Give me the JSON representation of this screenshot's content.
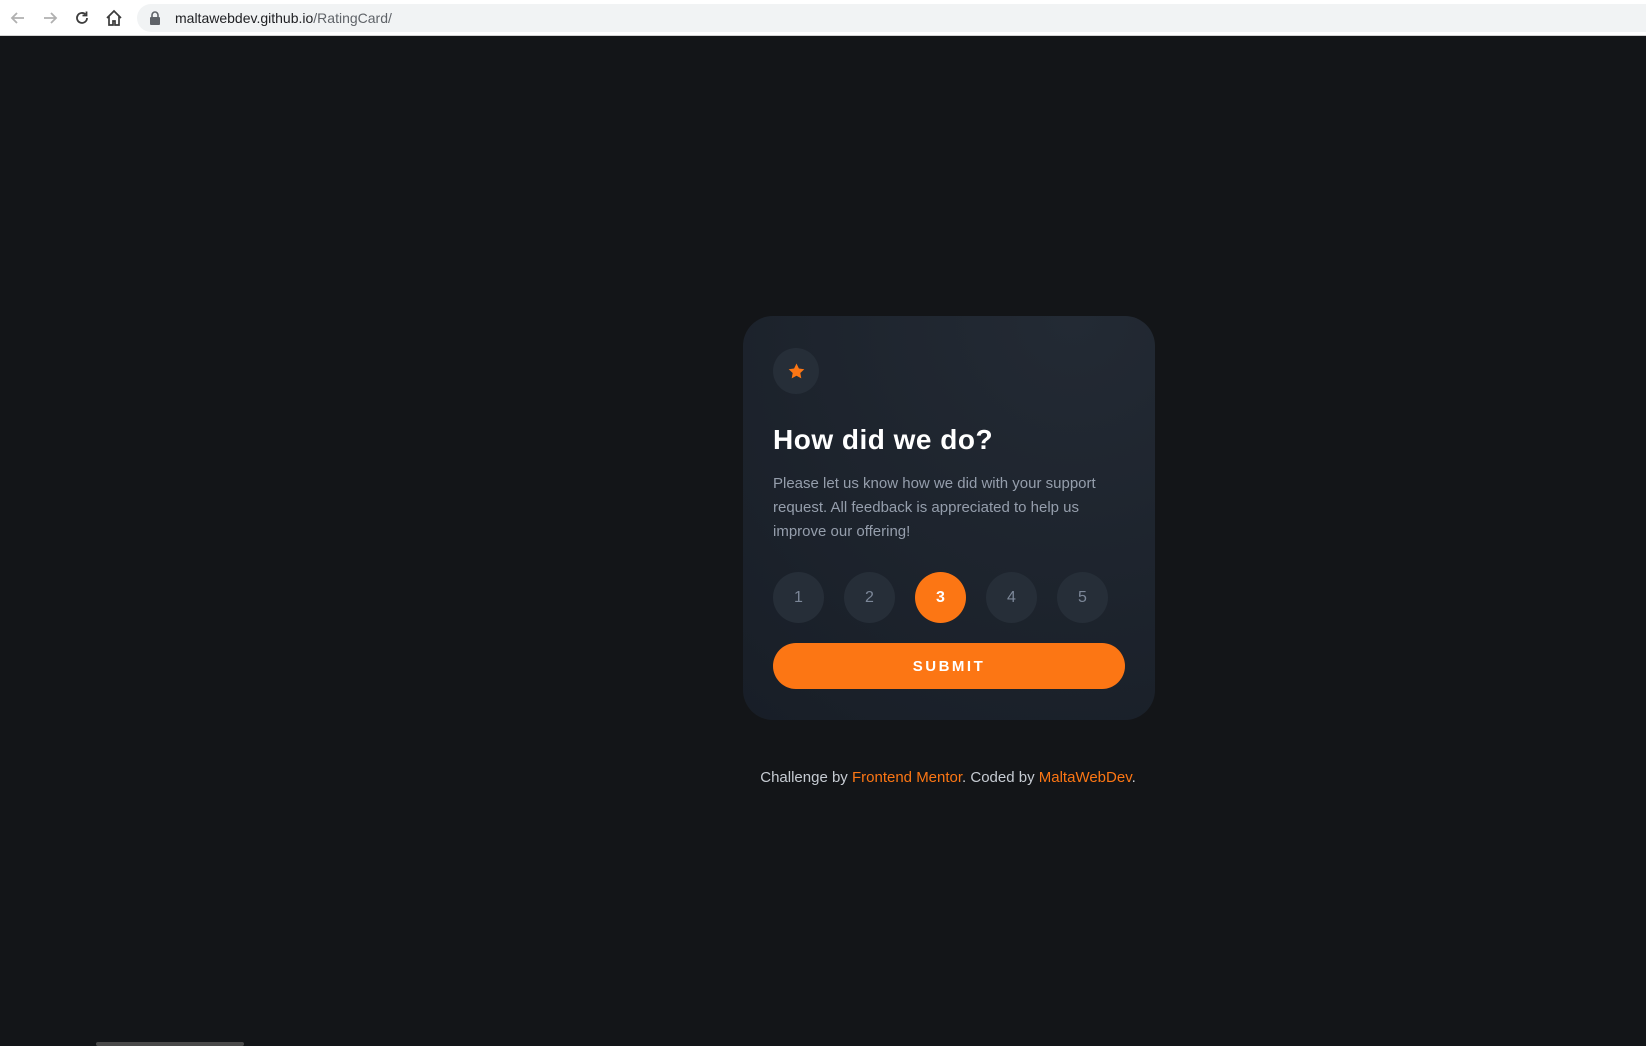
{
  "browser": {
    "url_host": "maltawebdev.github.io",
    "url_path": "/RatingCard/"
  },
  "card": {
    "icon": "star-icon",
    "title": "How did we do?",
    "description": "Please let us know how we did with your support request. All feedback is appreciated to help us improve our offering!",
    "ratings": [
      "1",
      "2",
      "3",
      "4",
      "5"
    ],
    "selected_rating": "3",
    "submit_label": "SUBMIT"
  },
  "attribution": {
    "prefix": "Challenge by ",
    "challenge_link": "Frontend Mentor",
    "middle": ". Coded by ",
    "author_link": "MaltaWebDev",
    "suffix": "."
  },
  "colors": {
    "accent": "#fc7614",
    "background": "#131518",
    "card": "#1f2630",
    "rating_circle": "#262e38",
    "muted_text": "#959eac"
  }
}
